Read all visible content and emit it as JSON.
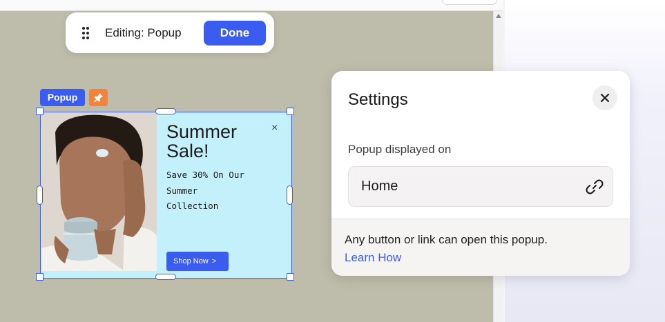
{
  "toolbar": {
    "editing_label": "Editing: Popup",
    "done_label": "Done"
  },
  "element_tags": {
    "popup_label": "Popup",
    "pin_icon": "pin-icon"
  },
  "popup": {
    "title_line1": "Summer",
    "title_line2": "Sale!",
    "close_glyph": "×",
    "subtitle_line1": "Save 30% On Our",
    "subtitle_line2": "Summer",
    "subtitle_line3": "Collection",
    "cta_label": "Shop Now",
    "cta_icon": "chevron-right-icon",
    "image": "woman-applying-skincare-cream-photo",
    "background_color": "#c3f0fa"
  },
  "settings": {
    "title": "Settings",
    "close_icon": "close-icon",
    "displayed_on_label": "Popup displayed on",
    "displayed_on_value": "Home",
    "link_icon": "link-icon",
    "footer_text": "Any button or link can open this popup.",
    "learn_how_label": "Learn How"
  },
  "colors": {
    "accent": "#3b5cf0",
    "pin_tag": "#f5823a",
    "canvas": "#bebcaa"
  }
}
